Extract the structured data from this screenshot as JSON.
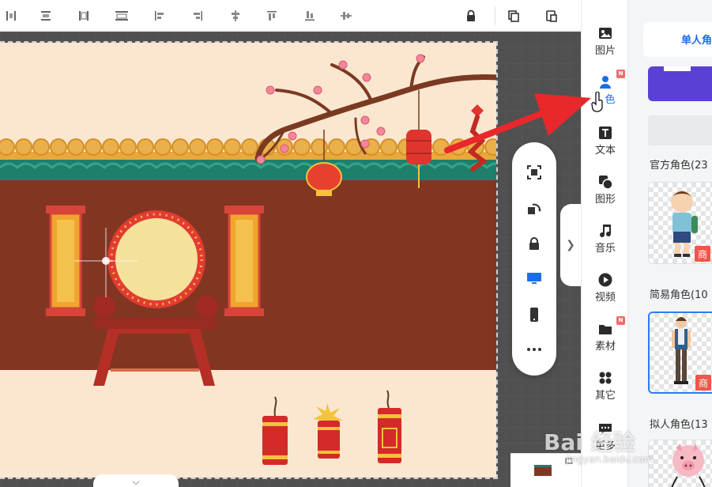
{
  "toolbar": {
    "icons": [
      "distribute-h-icon",
      "align-top-edge-icon",
      "align-vertical-bars-icon",
      "align-horizontal-bars-icon",
      "align-left-icon",
      "align-right-icon",
      "align-center-h-icon",
      "align-top-icon",
      "align-bottom-icon",
      "align-center-v-icon",
      "lock-icon",
      "copy-icon",
      "paste-icon"
    ]
  },
  "float_tools": [
    "fit-screen-icon",
    "rotate-icon",
    "lock-icon",
    "desktop-icon",
    "mobile-icon",
    "more-icon"
  ],
  "sidebar": {
    "items": [
      {
        "label": "图片",
        "icon": "image-icon",
        "active": false,
        "badge": ""
      },
      {
        "label": "角色",
        "label_visible": "色",
        "icon": "person-icon",
        "active": true,
        "badge": "N"
      },
      {
        "label": "文本",
        "icon": "text-icon",
        "active": false,
        "badge": ""
      },
      {
        "label": "图形",
        "icon": "shapes-icon",
        "active": false,
        "badge": ""
      },
      {
        "label": "音乐",
        "icon": "music-icon",
        "active": false,
        "badge": ""
      },
      {
        "label": "视频",
        "icon": "video-icon",
        "active": false,
        "badge": ""
      },
      {
        "label": "素材",
        "icon": "folder-icon",
        "active": false,
        "badge": "N"
      },
      {
        "label": "其它",
        "icon": "grid-icon",
        "active": false,
        "badge": ""
      },
      {
        "label": "更多",
        "icon": "chat-icon",
        "active": false,
        "badge": ""
      }
    ]
  },
  "asset_panel": {
    "sub_tab": "单人角",
    "sections": [
      {
        "label": "官方角色(23",
        "badge": "商"
      },
      {
        "label": "简易角色(10",
        "badge": "商"
      },
      {
        "label": "拟人角色(13",
        "badge": ""
      }
    ]
  },
  "watermark": {
    "main": "Bai 经验",
    "sub": "jingyan.baidu.com"
  },
  "colors": {
    "accent": "#1a6fe8",
    "stage_wall": "#823621",
    "stage_bg": "#fbe7d0",
    "arrow": "#e8282b",
    "badge": "#f0564a"
  }
}
